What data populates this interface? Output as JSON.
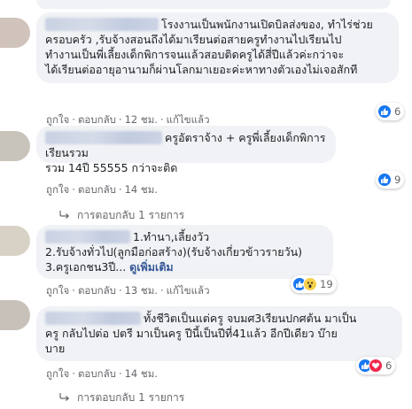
{
  "comments": [
    {
      "text_lines": [
        "โรงงานเป็นพนักงานเปิดบิลส่งของ, ทำไร่ช่วย",
        "ครอบครัว ,รับจ้างสอนถึงได้มาเรียนต่อสายครูทำงานไปเรียนไป",
        "ทำงานเป็นพี่เลี้ยงเด็กพิการจนแล้วสอบติดครูได้สี่ปีแล้วค่ะกว่าจะ",
        "ได้เรียนต่ออายุอานามก็ผ่านโลกมาเยอะค่ะหาทางตัวเองไม่เจอสักที"
      ],
      "like": "ถูกใจ",
      "reply": "ตอบกลับ",
      "time": "12 ชม.",
      "edited": "แก้ไขแล้ว",
      "reaction_count": "6"
    },
    {
      "text_lines": [
        "ครูอัตราจ้าง + ครูพี่เลี้ยงเด็กพิการเรียนรวม",
        "รวม 14ปี 55555 กว่าจะติด"
      ],
      "like": "ถูกใจ",
      "reply": "ตอบกลับ",
      "time": "14 ชม.",
      "reaction_count": "9",
      "replies_label": "การตอบกลับ 1 รายการ"
    },
    {
      "text_lines": [
        "1.ทำนา,เลี้ยงวัว",
        "2.รับจ้างทั่วไป(ลูกมือก่อสร้าง)(รับจ้างเกี่ยวข้าวรายวัน)",
        "3.ครูเอกชน3ปี...",
        "ดูเพิ่มเติม"
      ],
      "like": "ถูกใจ",
      "reply": "ตอบกลับ",
      "time": "13 ชม.",
      "edited": "แก้ไขแล้ว",
      "reaction_count": "19"
    },
    {
      "text_lines": [
        "ทั้งชีวิตเป็นแต่ครู จบมศ3เรียนปกศต้น มาเป็น",
        "ครู กลับไปต่อ ปตรี มาเป็นครู ปีนี้เป็นปีที่41แล้ว อีกปีเดียว บ๊าย",
        "บาย"
      ],
      "like": "ถูกใจ",
      "reply": "ตอบกลับ",
      "time": "14 ชม.",
      "reaction_count": "6",
      "replies_label": "การตอบกลับ 1 รายการ"
    }
  ],
  "colors": {
    "bubble": "#f0f2f5",
    "meta_text": "#65676b",
    "like_blue": "#1877f2",
    "link_blue": "#385898"
  },
  "icons": [
    "like-reaction-icon",
    "wow-reaction-icon",
    "love-reaction-icon",
    "reply-arrow-icon"
  ]
}
